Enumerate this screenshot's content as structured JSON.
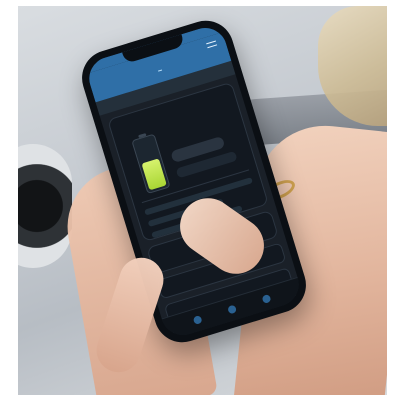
{
  "photo": {
    "subject": "phone-app-photo"
  },
  "app": {
    "status_time": "",
    "title": "",
    "tabs": [
      "",
      "",
      ""
    ],
    "subheader": "",
    "battery_percent": "",
    "labels": {
      "row1": "",
      "row2": "",
      "row3": ""
    }
  },
  "colors": {
    "accent": "#2f6fa7",
    "battery_fill": "#b6e24a",
    "dark_ui": "#121820"
  },
  "icons": {
    "menu": "menu-icon",
    "battery": "battery-icon",
    "nav": [
      "nav-icon-1",
      "nav-icon-2",
      "nav-icon-3"
    ]
  }
}
